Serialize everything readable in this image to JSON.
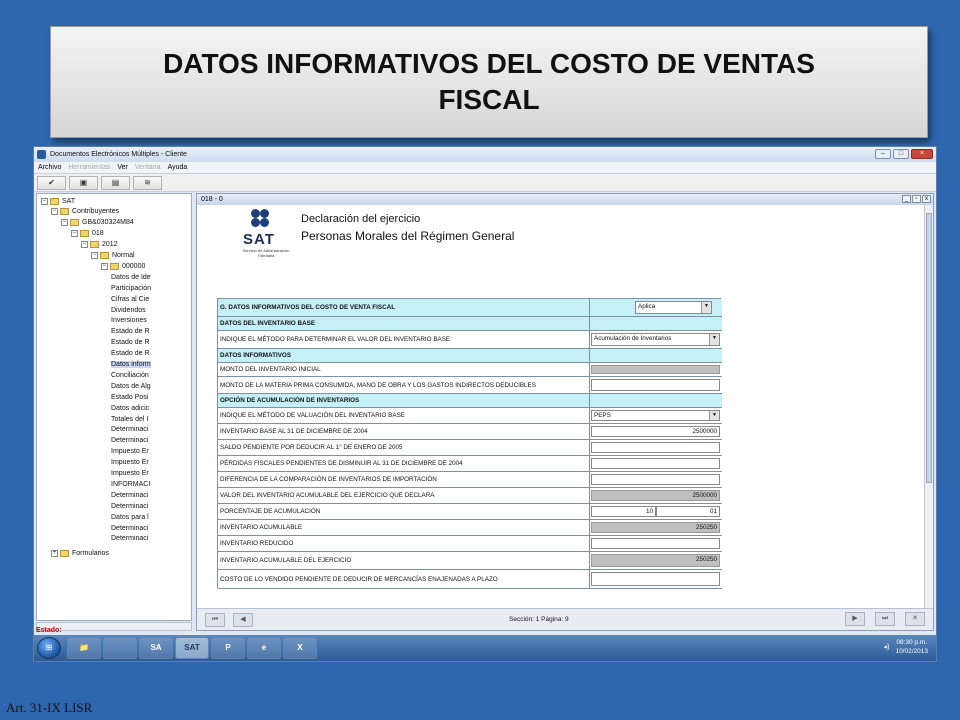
{
  "slide": {
    "title": "DATOS INFORMATIVOS DEL COSTO DE VENTAS FISCAL",
    "footer": "Art. 31-IX LISR"
  },
  "window": {
    "title": "Documentos Electrónicos Múltiples - Cliente",
    "menu": [
      "Archivo",
      "Herramientas",
      "Ver",
      "Ventana",
      "Ayuda"
    ],
    "menu_disabled": [
      false,
      true,
      false,
      true,
      false
    ]
  },
  "tree": [
    {
      "label": "SAT",
      "depth": 0,
      "exp": "−"
    },
    {
      "label": "Contribuyentes",
      "depth": 1,
      "exp": "−"
    },
    {
      "label": "GB&030324M84",
      "depth": 2,
      "exp": "−"
    },
    {
      "label": "018",
      "depth": 3,
      "exp": "−"
    },
    {
      "label": "2012",
      "depth": 4,
      "exp": "−"
    },
    {
      "label": "Normal",
      "depth": 5,
      "exp": "−"
    },
    {
      "label": "000000",
      "depth": 6,
      "exp": "−"
    },
    {
      "label": "Datos de Ide",
      "depth": 7
    },
    {
      "label": "Participación",
      "depth": 7
    },
    {
      "label": "Cifras al Cie",
      "depth": 7
    },
    {
      "label": "Dividendos",
      "depth": 7
    },
    {
      "label": "Inversiones",
      "depth": 7
    },
    {
      "label": "Estado de R",
      "depth": 7
    },
    {
      "label": "Estado de R",
      "depth": 7
    },
    {
      "label": "Estado de R",
      "depth": 7
    },
    {
      "label": "Datos inform",
      "depth": 7,
      "selected": true
    },
    {
      "label": "Conciliación",
      "depth": 7
    },
    {
      "label": "Datos de Alg",
      "depth": 7
    },
    {
      "label": "Estado Posi",
      "depth": 7
    },
    {
      "label": "Datos adicic",
      "depth": 7
    },
    {
      "label": "Totales del I",
      "depth": 7
    },
    {
      "label": "Determinaci",
      "depth": 7
    },
    {
      "label": "Determinaci",
      "depth": 7
    },
    {
      "label": "Impuesto Er",
      "depth": 7
    },
    {
      "label": "Impuesto Er",
      "depth": 7
    },
    {
      "label": "Impuesto Er",
      "depth": 7
    },
    {
      "label": "INFORMACI",
      "depth": 7
    },
    {
      "label": "Determinaci",
      "depth": 7
    },
    {
      "label": "Determinaci",
      "depth": 7
    },
    {
      "label": "Datos para l",
      "depth": 7
    },
    {
      "label": "Determinaci",
      "depth": 7
    },
    {
      "label": "Determinaci",
      "depth": 7
    },
    {
      "label": "Formularios",
      "depth": 1,
      "exp": "+"
    }
  ],
  "document": {
    "tab_title": "018 - 0",
    "sat_word": "SAT",
    "sat_sub": "Servicio de Administración Tributaria",
    "decl_title": "Declaración del ejercicio",
    "decl_sub": "Personas Morales del Régimen General",
    "status_label": "Estado:",
    "section": "Sección: 1  Página: 9"
  },
  "form": [
    {
      "label": "G. DATOS INFORMATIVOS DEL COSTO DE VENTA FISCAL",
      "header": true,
      "kind": "combo",
      "value": "Aplica"
    },
    {
      "label": "DATOS DEL INVENTARIO BASE",
      "header": true,
      "kind": "none"
    },
    {
      "label": "INDIQUE EL MÉTODO PARA DETERMINAR EL VALOR DEL INVENTARIO BASE:",
      "kind": "combo2",
      "value": "Acumulación de Inventarios"
    },
    {
      "label": "DATOS INFORMATIVOS",
      "header": true,
      "kind": "none"
    },
    {
      "label": "MONTO DEL INVENTARIO INICIAL",
      "kind": "gray",
      "value": ""
    },
    {
      "label": "MONTO DE LA MATERIA PRIMA CONSUMIDA, MANO DE OBRA Y LOS GASTOS INDIRECTOS DEDUCIBLES",
      "kind": "white",
      "value": ""
    },
    {
      "label": "OPCIÓN DE ACUMULACIÓN DE INVENTARIOS",
      "header": true,
      "kind": "none"
    },
    {
      "label": "INDIQUE EL MÉTODO DE VALUACIÓN DEL INVENTARIO BASE",
      "kind": "combo2",
      "value": "PEPS"
    },
    {
      "label": "INVENTARIO BASE AL 31 DE DICIEMBRE DE 2004",
      "kind": "white",
      "value": "2500000"
    },
    {
      "label": "SALDO PENDIENTE POR DEDUCIR AL 1° DE ENERO DE 2005",
      "kind": "white",
      "value": ""
    },
    {
      "label": "PÉRDIDAS FISCALES PENDIENTES DE DISMINUIR AL 31 DE DICIEMBRE DE 2004",
      "kind": "white",
      "value": ""
    },
    {
      "label": "DIFERENCIA DE LA COMPARACIÓN DE INVENTARIOS DE IMPORTACIÓN",
      "kind": "white",
      "value": ""
    },
    {
      "label": "VALOR DEL INVENTARIO ACUMULABLE DEL EJERCICIO QUE DECLARA",
      "kind": "gray",
      "value": "2500000"
    },
    {
      "label": "PORCENTAJE DE ACUMULACIÓN",
      "kind": "split",
      "value": "10",
      "value2": "01"
    },
    {
      "label": "INVENTARIO ACUMULABLE",
      "kind": "gray",
      "value": "250250"
    },
    {
      "label": "INVENTARIO REDUCIDO",
      "kind": "white",
      "value": ""
    },
    {
      "label": "INVENTARIO ACUMULABLE DEL EJERCICIO",
      "kind": "gray",
      "value": "250250"
    },
    {
      "label": "COSTO DE LO VENDIDO PENDIENTE DE DEDUCIR DE MERCANCÍAS ENAJENADAS A PLAZO",
      "kind": "white",
      "value": ""
    }
  ],
  "taskbar": {
    "apps": [
      "",
      "",
      "SA",
      "SAT",
      "",
      "",
      ""
    ],
    "time": "08:30 p.m.",
    "date": "10/02/2013"
  }
}
